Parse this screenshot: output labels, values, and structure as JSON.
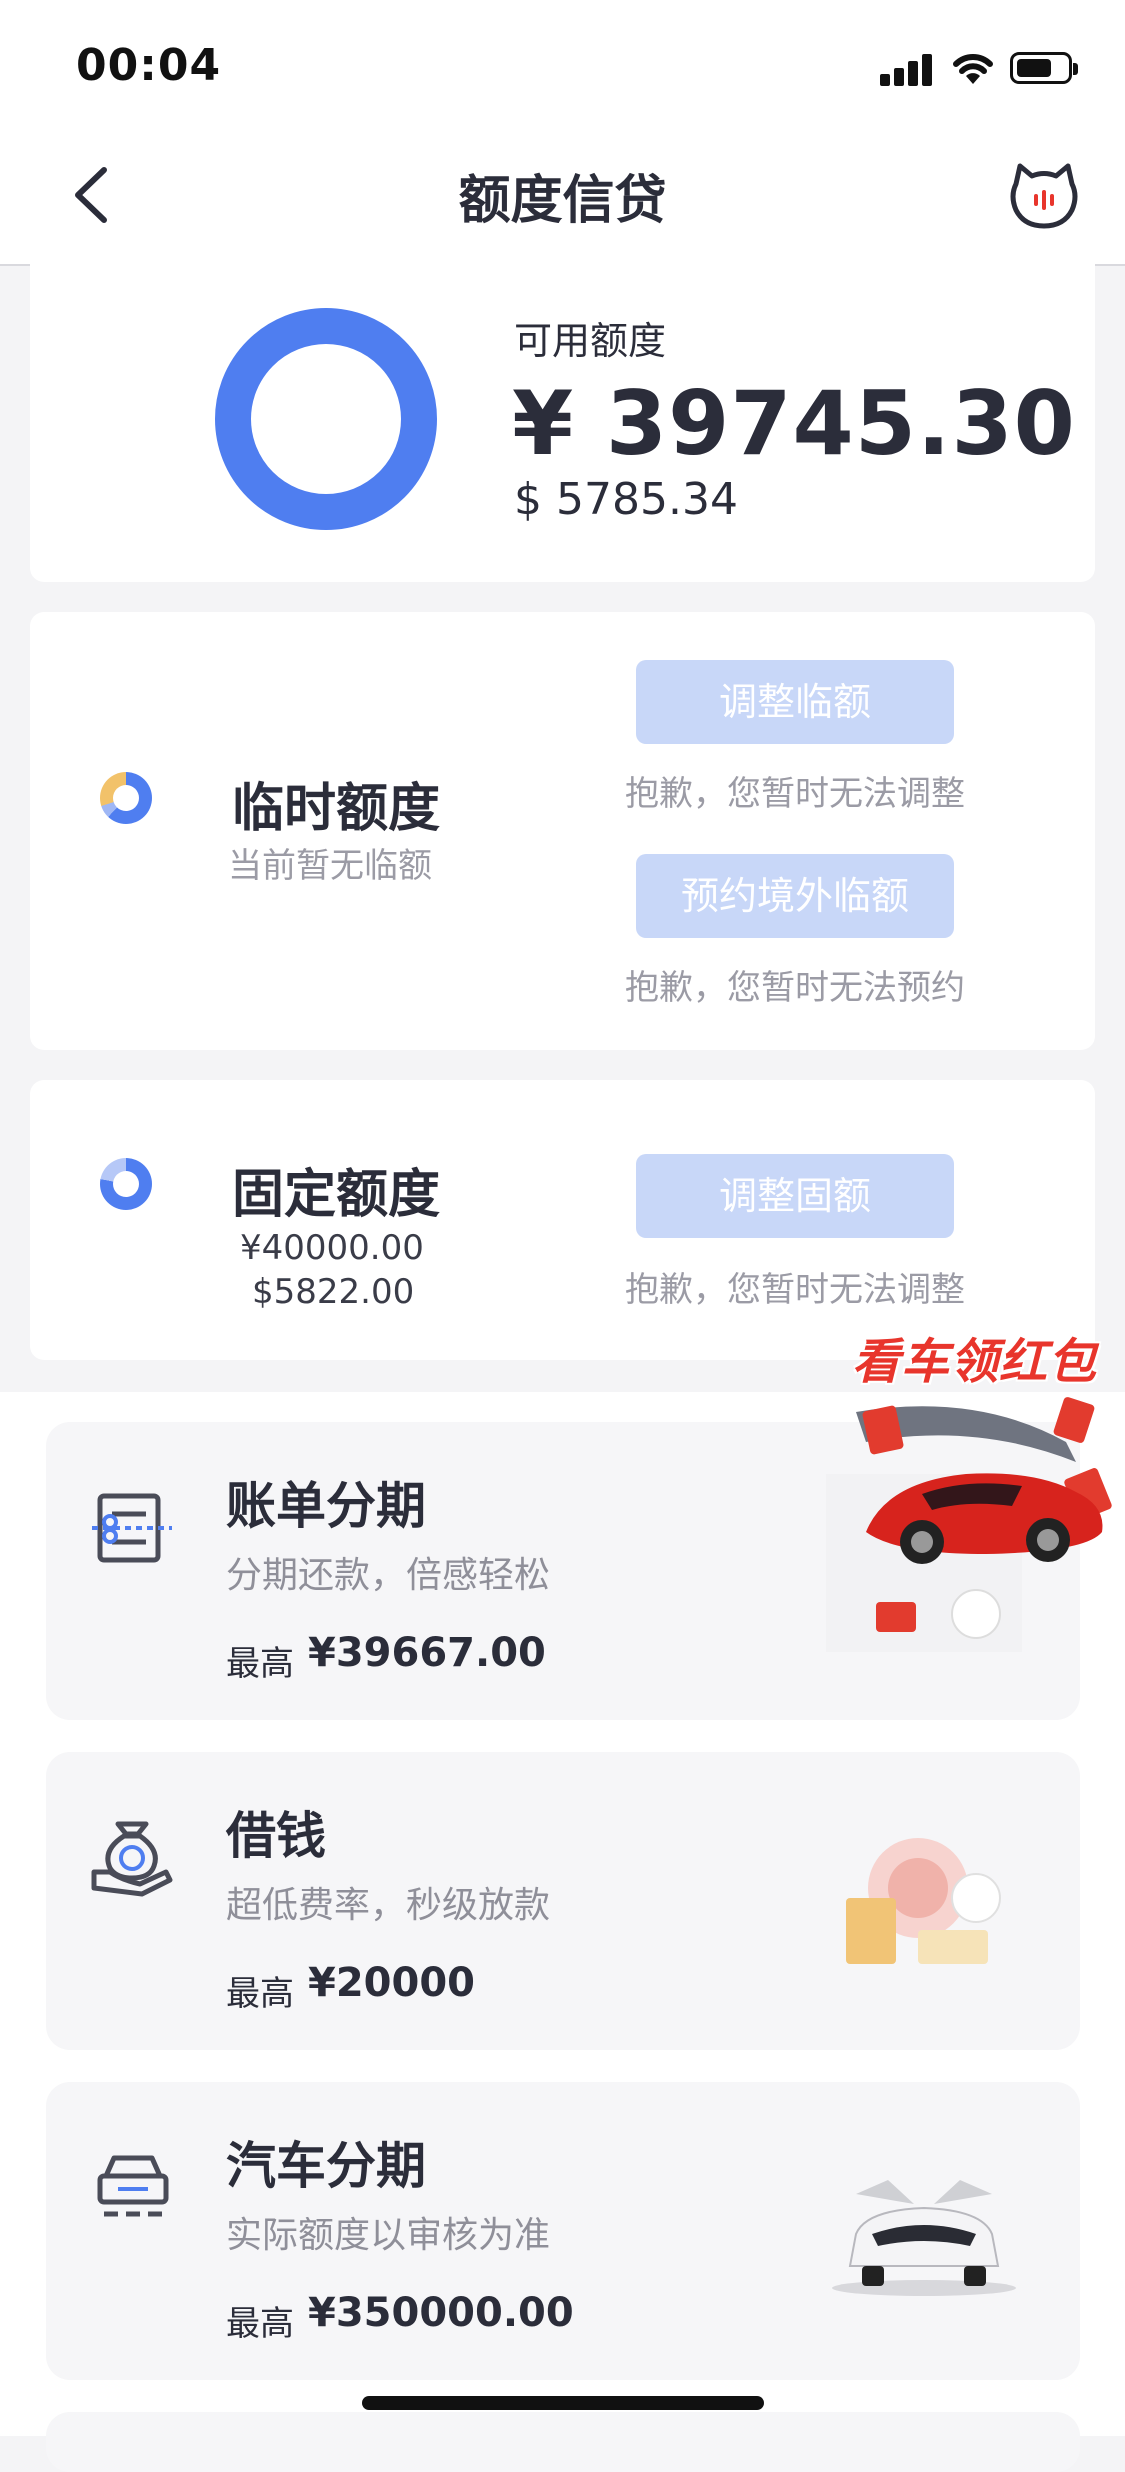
{
  "status_bar": {
    "time": "00:04"
  },
  "nav": {
    "title": "额度信贷"
  },
  "available": {
    "label": "可用额度",
    "cny": "¥ 39745.30",
    "usd": "$ 5785.34"
  },
  "temporary": {
    "title": "临时额度",
    "subtitle": "当前暂无临额",
    "adjust_button": "调整临额",
    "adjust_hint": "抱歉，您暂时无法调整",
    "book_button": "预约境外临额",
    "book_hint": "抱歉，您暂时无法预约"
  },
  "fixed": {
    "title": "固定额度",
    "cny": "¥40000.00",
    "usd": "$5822.00",
    "adjust_button": "调整固额",
    "adjust_hint": "抱歉，您暂时无法调整"
  },
  "promo": {
    "banner": "看车领红包"
  },
  "products": [
    {
      "title": "账单分期",
      "subtitle": "分期还款，倍感轻松",
      "max_label": "最高",
      "max_value": "¥39667.00",
      "icon": "bill-installment-icon"
    },
    {
      "title": "借钱",
      "subtitle": "超低费率，秒级放款",
      "max_label": "最高",
      "max_value": "¥20000",
      "icon": "borrow-money-icon"
    },
    {
      "title": "汽车分期",
      "subtitle": "实际额度以审核为准",
      "max_label": "最高",
      "max_value": "¥350000.00",
      "icon": "car-icon"
    }
  ],
  "colors": {
    "accent": "#4f7ef0",
    "button_disabled": "#c8d7f8",
    "promo_red": "#e8352c"
  }
}
